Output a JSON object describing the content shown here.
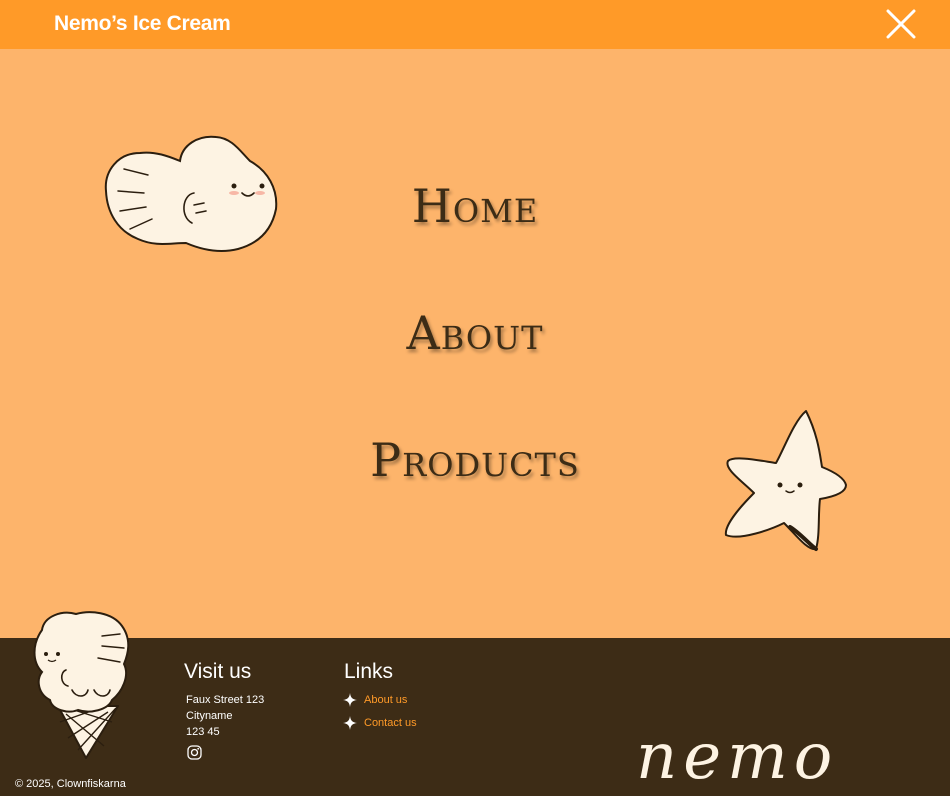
{
  "header": {
    "brand": "Nemo’s Ice Cream",
    "close_icon": "close-icon"
  },
  "menu": {
    "items": [
      {
        "label": "Home"
      },
      {
        "label": "About"
      },
      {
        "label": "Products"
      }
    ],
    "decorations": [
      "fish-illustration",
      "starfish-illustration"
    ]
  },
  "footer": {
    "visit_us": {
      "heading": "Visit us",
      "address_lines": [
        "Faux Street 123",
        "Cityname",
        "123 45"
      ],
      "social_icon": "instagram-icon"
    },
    "links": {
      "heading": "Links",
      "items": [
        {
          "label": "About us",
          "icon": "sparkle-icon"
        },
        {
          "label": "Contact us",
          "icon": "sparkle-icon"
        }
      ]
    },
    "copyright": "© 2025, Clownfiskarna",
    "logo_text": "nemo",
    "mascot": "ice-cream-cone-illustration"
  },
  "colors": {
    "header_bg": "#ff9a28",
    "menu_bg": "#fdb46b",
    "footer_bg": "#3d2c16",
    "link_accent": "#ff9a28",
    "menu_text": "#3c2c16",
    "cream": "#fdf3e3"
  }
}
